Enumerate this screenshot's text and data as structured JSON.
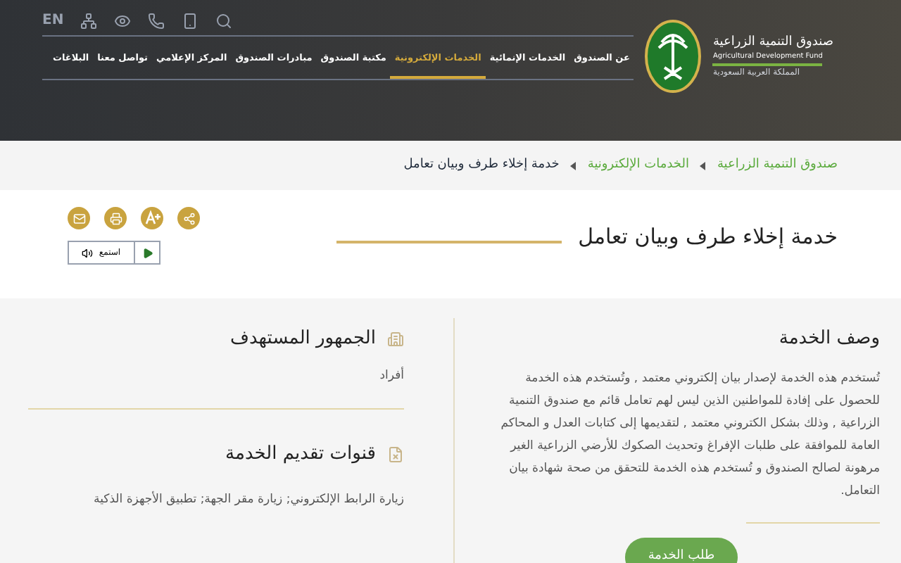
{
  "header": {
    "language_link": "EN",
    "logo": {
      "name_ar": "صندوق التنمية الزراعية",
      "name_en": "Agricultural Development Fund",
      "country": "المملكة العربية السعودية"
    },
    "nav": [
      {
        "label": "عن الصندوق",
        "selected": false
      },
      {
        "label": "الخدمات الإنمائية",
        "selected": false
      },
      {
        "label": "الخدمات الإلكترونية",
        "selected": true
      },
      {
        "label": "مكتبة الصندوق",
        "selected": false
      },
      {
        "label": "مبادرات الصندوق",
        "selected": false
      },
      {
        "label": "المركز الإعلامي",
        "selected": false
      },
      {
        "label": "تواصل معنا",
        "selected": false
      },
      {
        "label": "البلاغات",
        "selected": false
      }
    ]
  },
  "breadcrumb": [
    {
      "label": "صندوق التنمية الزراعية",
      "kind": "link"
    },
    {
      "label": "الخدمات الإلكترونية",
      "kind": "link"
    },
    {
      "label": "خدمة إخلاء طرف وبيان تعامل",
      "kind": "current"
    }
  ],
  "page_title": "خدمة إخلاء طرف وبيان تعامل",
  "listen_button": "استمع",
  "description": {
    "title": "وصف الخدمة",
    "text": " تُستخدم هذه الخدمة لإصدار بيان إلكتروني معتمد , وتُستخدم هذه الخدمة للحصول على إفادة للمواطنين  الذين ليس لهم تعامل قائم مع صندوق التنمية الزراعية , وذلك بشكل الكتروني معتمد , لتقديمها إلى كتابات العدل و المحاكم العامة للموافقة على طلبات الإفراغ وتحديث الصكوك للأرضي الزراعية الغير مرهونة لصالح الصندوق و تُستخدم هذه الخدمة للتحقق من صحة شهادة بيان التعامل."
  },
  "request_button": "طلب الخدمة",
  "audience": {
    "title": "الجمهور المستهدف",
    "text": "أفراد"
  },
  "channels": {
    "title": "قنوات تقديم الخدمة",
    "text": "زيارة الرابط الإلكتروني; زيارة مقر الجهة; تطبيق الأجهزة الذكية"
  }
}
